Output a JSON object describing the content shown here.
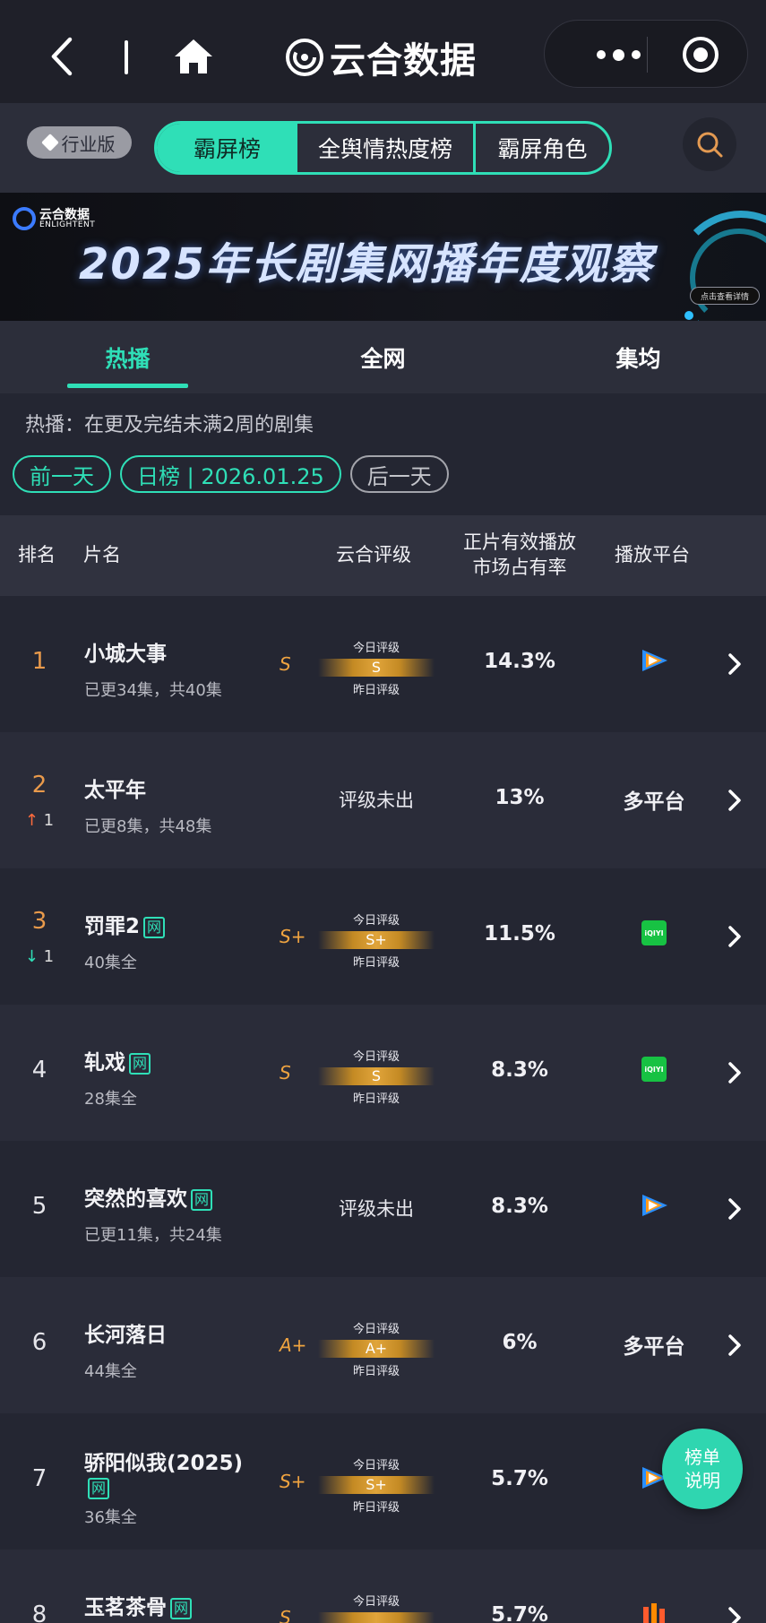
{
  "nav": {
    "title": "云合数据"
  },
  "tabbar": {
    "industry_label": "行业版",
    "tabs": [
      "霸屏榜",
      "全舆情热度榜",
      "霸屏角色"
    ]
  },
  "banner": {
    "logo_text": "云合数据",
    "logo_subtext": "ENLIGHTENT",
    "title": "2025年长剧集网播年度观察",
    "cta": "点击查看详情"
  },
  "subtabs": [
    "热播",
    "全网",
    "集均"
  ],
  "description": "热播：在更及完结未满2周的剧集",
  "date_controls": {
    "prev": "前一天",
    "current": "日榜 | 2026.01.25",
    "next": "后一天"
  },
  "table": {
    "headers": {
      "rank": "排名",
      "title": "片名",
      "rating": "云合评级",
      "share_line1": "正片有效播放",
      "share_line2": "市场占有率",
      "platform": "播放平台"
    },
    "rating_today_label": "今日评级",
    "rating_yesterday_label": "昨日评级",
    "rating_pending_label": "评级未出",
    "net_tag": "网",
    "rows": [
      {
        "rank": "1",
        "title": "小城大事",
        "tag": false,
        "sub": "已更34集，共40集",
        "grade": "S",
        "bar": "S",
        "share": "14.3%",
        "platform": "tencent",
        "move": ""
      },
      {
        "rank": "2",
        "title": "太平年",
        "tag": false,
        "sub": "已更8集，共48集",
        "grade": "",
        "bar": "",
        "share": "13%",
        "platform_text": "多平台",
        "move": "up",
        "move_value": "1"
      },
      {
        "rank": "3",
        "title": "罚罪2",
        "tag": true,
        "sub": "40集全",
        "grade": "S+",
        "bar": "S+",
        "share": "11.5%",
        "platform": "iqiyi",
        "move": "down",
        "move_value": "1"
      },
      {
        "rank": "4",
        "title": "轧戏",
        "tag": true,
        "sub": "28集全",
        "grade": "S",
        "bar": "S",
        "share": "8.3%",
        "platform": "iqiyi",
        "move": ""
      },
      {
        "rank": "5",
        "title": "突然的喜欢",
        "tag": true,
        "sub": "已更11集，共24集",
        "grade": "",
        "bar": "",
        "share": "8.3%",
        "platform": "tencent",
        "move": ""
      },
      {
        "rank": "6",
        "title": "长河落日",
        "tag": false,
        "sub": "44集全",
        "grade": "A+",
        "bar": "A+",
        "share": "6%",
        "platform_text": "多平台",
        "move": ""
      },
      {
        "rank": "7",
        "title": "骄阳似我(2025)",
        "tag": true,
        "sub": "36集全",
        "grade": "S+",
        "bar": "S+",
        "share": "5.7%",
        "platform": "tencent",
        "move": ""
      },
      {
        "rank": "8",
        "title": "玉茗茶骨",
        "tag": true,
        "sub": "",
        "grade": "S",
        "bar": "",
        "share": "5.7%",
        "platform": "youku",
        "move": ""
      }
    ]
  },
  "fab": {
    "line1": "榜单",
    "line2": "说明"
  },
  "colors": {
    "accent": "#2fdfb7",
    "gold": "#e0a43a",
    "rank_top": "#e99a4b",
    "up": "#ff6b3d"
  }
}
